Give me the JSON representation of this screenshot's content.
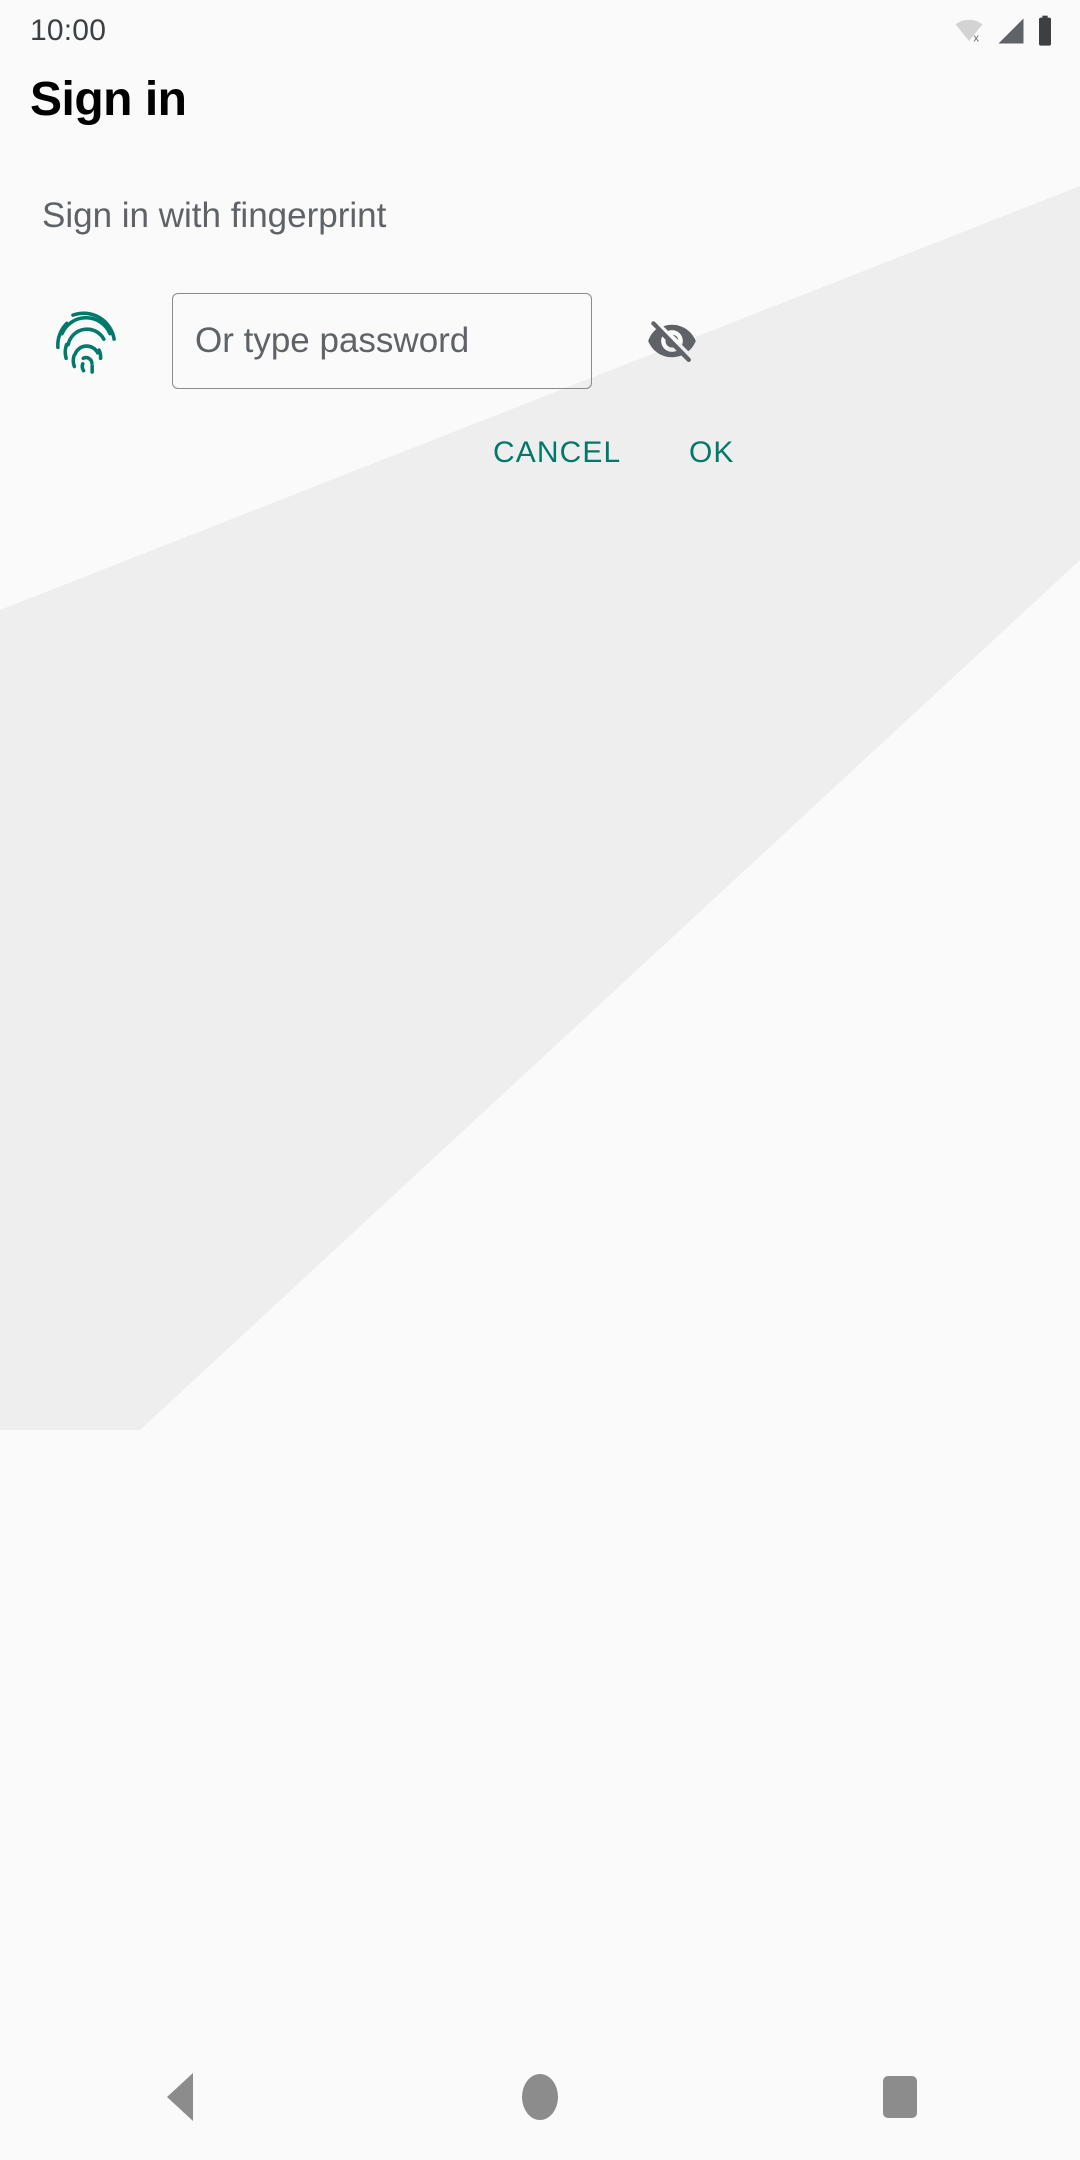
{
  "status_bar": {
    "clock": "10:00",
    "icons": [
      {
        "name": "wifi-off-icon",
        "label": "Wi-Fi disconnected"
      },
      {
        "name": "cellular-signal-icon",
        "label": "Cellular signal"
      },
      {
        "name": "battery-icon",
        "label": "Battery full"
      }
    ]
  },
  "header": {
    "title": "Sign in"
  },
  "dialog": {
    "subtitle": "Sign in with fingerprint",
    "fingerprint_icon": "fingerprint-icon",
    "password": {
      "value": "",
      "placeholder": "Or type password",
      "toggle_icon": "visibility-off-icon"
    },
    "buttons": {
      "cancel": "CANCEL",
      "ok": "OK"
    }
  },
  "nav_bar": {
    "back": "back-icon",
    "home": "home-icon",
    "recents": "recents-icon"
  },
  "colors": {
    "accent": "#00796b",
    "background": "#fafafa",
    "band": "#eeeeee",
    "text_primary": "#000000",
    "text_secondary": "#5f6368",
    "icon_gray": "#8c8c8c",
    "field_border": "#8a8a8a"
  }
}
